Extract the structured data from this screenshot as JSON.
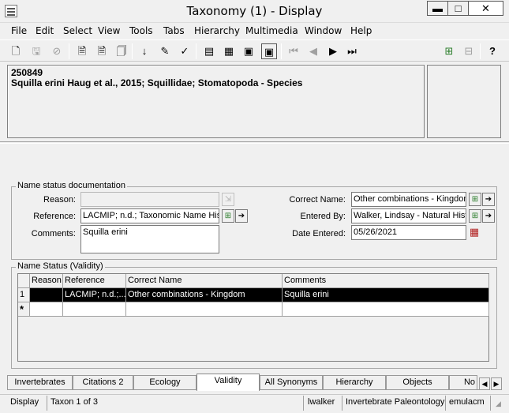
{
  "window": {
    "title": "Taxonomy (1) - Display",
    "controls": {
      "minimize": "▬",
      "maximize": "□",
      "close": "✕"
    }
  },
  "menu": [
    "File",
    "Edit",
    "Select",
    "View",
    "Tools",
    "Tabs",
    "Hierarchy",
    "Multimedia",
    "Window",
    "Help"
  ],
  "header": {
    "record_id": "250849",
    "record_name": "Squilla erini Haug et al., 2015; Squillidae; Stomatopoda - Species"
  },
  "name_status_documentation": {
    "group_title": "Name status documentation",
    "reason_label": "Reason:",
    "reason_value": "",
    "reference_label": "Reference:",
    "reference_value": "LACMIP; n.d.; Taxonomic Name Hist",
    "comments_label": "Comments:",
    "comments_value": "Squilla erini",
    "correct_name_label": "Correct Name:",
    "correct_name_value": "Other combinations - Kingdom",
    "entered_by_label": "Entered By:",
    "entered_by_value": "Walker, Lindsay - Natural Hist",
    "date_entered_label": "Date Entered:",
    "date_entered_value": "05/26/2021"
  },
  "name_status_grid": {
    "group_title": "Name Status (Validity)",
    "columns": [
      "Reason",
      "Reference",
      "Correct Name",
      "Comments"
    ],
    "rows": [
      {
        "num": "1",
        "reason": "",
        "reference": "LACMIP; n.d.;...",
        "correct_name": "Other combinations - Kingdom",
        "comments": "Squilla erini"
      }
    ],
    "new_row_marker": "*"
  },
  "tabs": [
    {
      "label": "Invertebrates",
      "active": false
    },
    {
      "label": "Citations 2",
      "active": false
    },
    {
      "label": "Ecology",
      "active": false
    },
    {
      "label": "Validity",
      "active": true
    },
    {
      "label": "All Synonyms",
      "active": false
    },
    {
      "label": "Hierarchy",
      "active": false
    },
    {
      "label": "Objects",
      "active": false
    },
    {
      "label": "No",
      "active": false
    }
  ],
  "status_bar": {
    "mode": "Display",
    "position": "Taxon 1 of 3",
    "user": "lwalker",
    "department": "Invertebrate Paleontology",
    "database": "emulacm"
  }
}
